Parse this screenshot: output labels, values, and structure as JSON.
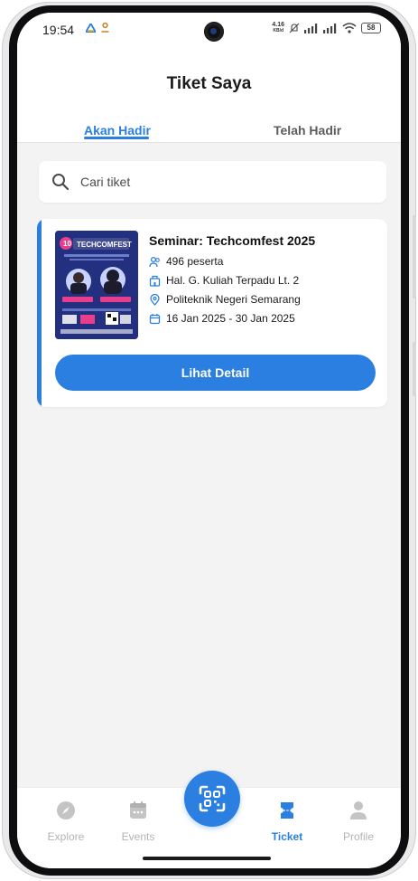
{
  "status_bar": {
    "time": "19:54",
    "net_speed_top": "4.16",
    "net_speed_bottom": "KB/d",
    "battery": "58"
  },
  "header": {
    "title": "Tiket Saya",
    "tabs": [
      {
        "label": "Akan Hadir",
        "active": true
      },
      {
        "label": "Telah Hadir",
        "active": false
      }
    ]
  },
  "search": {
    "placeholder": "Cari tiket",
    "value": ""
  },
  "tickets": [
    {
      "title": "Seminar: Techcomfest 2025",
      "participants": "496 peserta",
      "venue": "Hal. G. Kuliah Terpadu Lt. 2",
      "organizer": "Politeknik Negeri Semarang",
      "date_range": "16 Jan 2025 - 30 Jan 2025",
      "poster_text": "TECHCOMFEST",
      "detail_button": "Lihat Detail"
    }
  ],
  "bottom_nav": {
    "items": [
      {
        "label": "Explore",
        "icon": "compass-icon",
        "active": false
      },
      {
        "label": "Events",
        "icon": "calendar-icon",
        "active": false
      },
      {
        "label": "Ticket",
        "icon": "ticket-icon",
        "active": true
      },
      {
        "label": "Profile",
        "icon": "person-icon",
        "active": false
      }
    ],
    "scan_icon": "qr-scan-icon"
  },
  "colors": {
    "accent": "#2a7fe0",
    "background": "#f3f3f4",
    "inactive": "#b3b3b3"
  }
}
